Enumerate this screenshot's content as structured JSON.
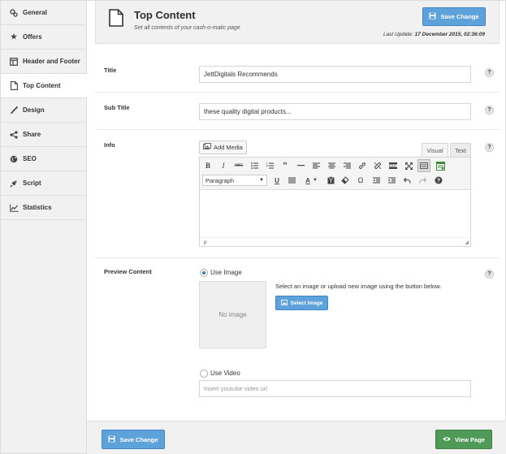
{
  "sidebar": {
    "items": [
      {
        "label": "General",
        "icon": "gears-icon"
      },
      {
        "label": "Offers",
        "icon": "star-icon"
      },
      {
        "label": "Header and Footer",
        "icon": "layout-icon"
      },
      {
        "label": "Top Content",
        "icon": "document-icon",
        "active": true
      },
      {
        "label": "Design",
        "icon": "brush-icon"
      },
      {
        "label": "Share",
        "icon": "share-icon"
      },
      {
        "label": "SEO",
        "icon": "globe-icon"
      },
      {
        "label": "Script",
        "icon": "plug-icon"
      },
      {
        "label": "Statistics",
        "icon": "line-chart-icon"
      }
    ]
  },
  "header": {
    "title": "Top Content",
    "subtitle": "Set all contents of your cash-o-matic page",
    "save_label": "Save Change",
    "last_update_label": "Last Update:",
    "last_update_value": "17 December 2015, 02:36:09"
  },
  "fields": {
    "title_label": "Title",
    "title_value": "JettDigitals Recommends",
    "subtitle_label": "Sub Title",
    "subtitle_value": "these quality digital products...",
    "info_label": "Info",
    "help_glyph": "?"
  },
  "editor": {
    "add_media_label": "Add Media",
    "tab_visual": "Visual",
    "tab_text": "Text",
    "paragraph_select": "Paragraph",
    "path_text": "p"
  },
  "preview": {
    "label": "Preview Content",
    "use_image_label": "Use Image",
    "no_image_text": "No image",
    "select_instructions": "Select an image or upload new image using the button below.",
    "select_image_label": "Select Image",
    "use_video_label": "Use Video",
    "video_placeholder": "Insert youtube video url"
  },
  "footer": {
    "save_label": "Save Change",
    "view_label": "View Page"
  },
  "colors": {
    "primary_blue": "#5ea2dc",
    "view_green": "#4f9a57",
    "sidebar_bg": "#f1f1f1"
  }
}
